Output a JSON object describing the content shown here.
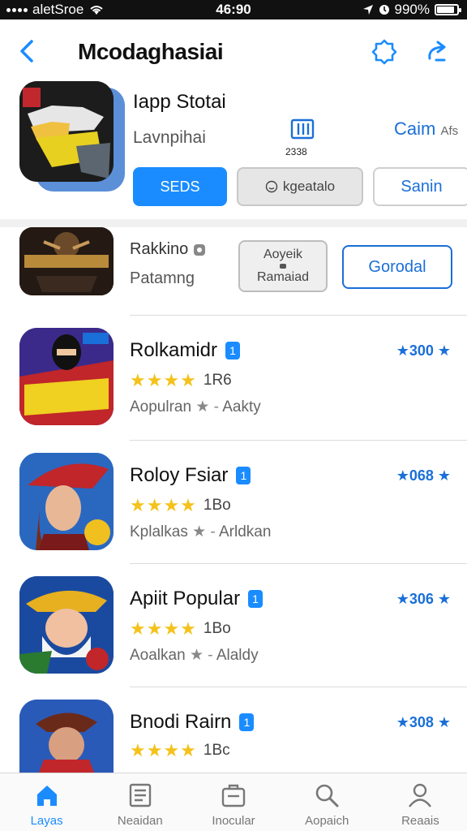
{
  "status_bar": {
    "carrier": "aletSroe",
    "time": "46:90",
    "battery": "990%",
    "battery_level": 0.9
  },
  "nav": {
    "title": "Mcodaghasiai"
  },
  "featured": {
    "title": "Iapp Stotai",
    "subtitle": "Lavnpihai",
    "stat_value": "2338",
    "link": "Caim",
    "link_suffix": "Afs",
    "buttons": {
      "primary": "SEDS",
      "secondary": "kgeatalo",
      "outline": "Sanin"
    }
  },
  "secondary_row": {
    "line1": "Rakkino",
    "line2": "Patamng",
    "button_line1": "Aoyeik",
    "button_line2": "Ramaiad",
    "button2": "Gorodal"
  },
  "apps": [
    {
      "title": "Rolkamidr",
      "badge": "1",
      "rating_count": "1R6",
      "category": "Aopulran",
      "tag": "Aakty",
      "price": "★300 ★",
      "stars": 4
    },
    {
      "title": "Roloy Fsiar",
      "badge": "1",
      "rating_count": "1Bo",
      "category": "Kplalkas",
      "tag": "Arldkan",
      "price": "★068 ★",
      "stars": 4
    },
    {
      "title": "Apiit Popular",
      "badge": "1",
      "rating_count": "1Bo",
      "category": "Aoalkan",
      "tag": "Alaldy",
      "price": "★306 ★",
      "stars": 4
    },
    {
      "title": "Bnodi Rairn",
      "badge": "1",
      "rating_count": "1Bc",
      "category": "",
      "tag": "",
      "price": "★308 ★",
      "stars": 4
    }
  ],
  "tabs": [
    {
      "label": "Layas",
      "icon": "home-icon",
      "active": true
    },
    {
      "label": "Neaidan",
      "icon": "list-icon",
      "active": false
    },
    {
      "label": "Inocular",
      "icon": "briefcase-icon",
      "active": false
    },
    {
      "label": "Aopaich",
      "icon": "search-icon",
      "active": false
    },
    {
      "label": "Reaais",
      "icon": "person-icon",
      "active": false
    }
  ],
  "colors": {
    "accent": "#1a8cff",
    "link": "#1a6fd8",
    "star": "#f4c21b"
  }
}
